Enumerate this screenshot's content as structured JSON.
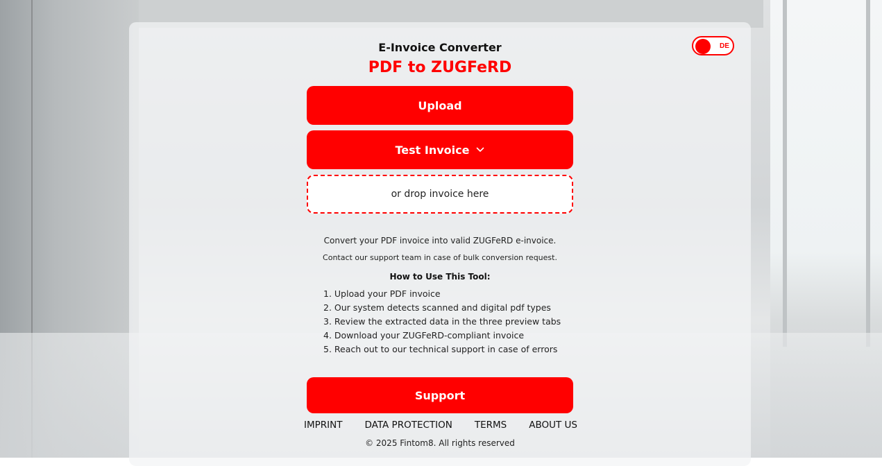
{
  "header": {
    "title": "E-Invoice Converter",
    "subtitle": "PDF to ZUGFeRD"
  },
  "language_toggle": {
    "label": "DE"
  },
  "actions": {
    "upload_label": "Upload",
    "test_invoice_label": "Test Invoice",
    "dropzone_text": "or drop invoice here",
    "support_label": "Support"
  },
  "info": {
    "description": "Convert your PDF invoice into valid ZUGFeRD e-invoice.",
    "contact_note": "Contact our support team in case of bulk conversion request.",
    "howto_title": "How to Use This Tool:",
    "steps": [
      "1. Upload your PDF invoice",
      "2. Our system detects scanned and digital pdf types",
      "3. Review the extracted data in the three preview tabs",
      "4. Download your ZUGFeRD-compliant invoice",
      "5. Reach out to our technical support in case of errors"
    ]
  },
  "footer": {
    "links": [
      "IMPRINT",
      "DATA PROTECTION",
      "TERMS",
      "ABOUT US"
    ],
    "copyright": "© 2025 Fintom8. All rights reserved"
  },
  "colors": {
    "accent": "#ff0000",
    "panel": "#f3f4f5",
    "text": "#111111"
  },
  "icons": {
    "test_invoice_dropdown": "chevron-down-icon"
  }
}
